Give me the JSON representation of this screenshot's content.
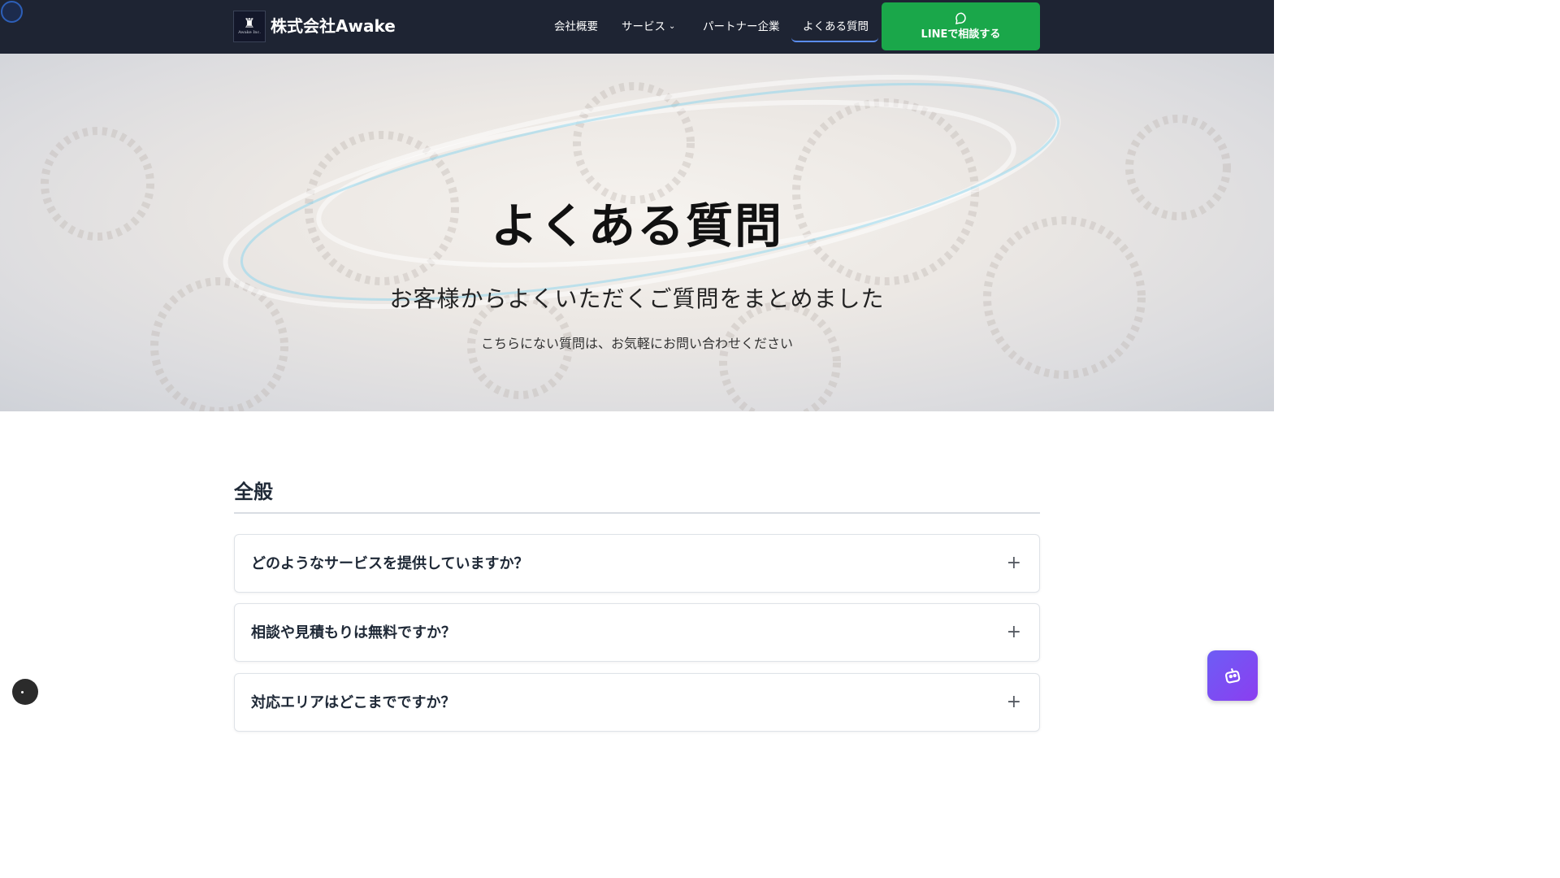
{
  "header": {
    "logo_text": "Awake Inc.",
    "brand": "株式会社Awake",
    "nav": [
      {
        "label": "会社概要"
      },
      {
        "label": "サービス"
      },
      {
        "label": "パートナー企業"
      },
      {
        "label": "よくある質問"
      }
    ],
    "cta_label": "LINEで相談する",
    "cta_icon": "chat-bubble-icon"
  },
  "hero": {
    "title": "よくある質問",
    "subtitle": "お客様からよくいただくご質問をまとめました",
    "note": "こちらにない質問は、お気軽にお問い合わせください"
  },
  "faq": {
    "section_title": "全般",
    "items": [
      {
        "question": "どのようなサービスを提供していますか？"
      },
      {
        "question": "相談や見積もりは無料ですか？"
      },
      {
        "question": "対応エリアはどこまでですか？"
      }
    ],
    "expand_symbol": "+"
  },
  "colors": {
    "header_bg": "#1e2433",
    "cta_green": "#1aa74a",
    "active_underline": "#5b8def",
    "bot_purple": "#7c4cf2"
  }
}
